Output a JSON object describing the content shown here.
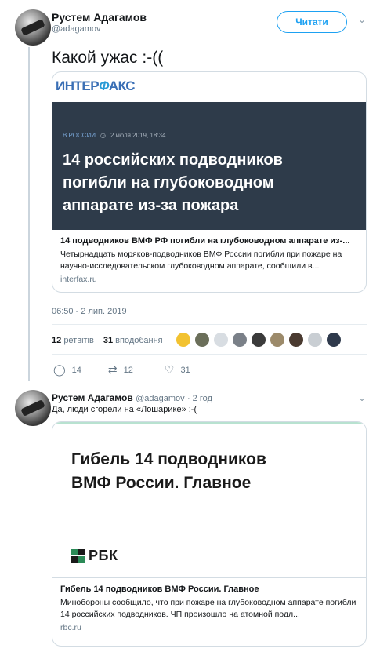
{
  "tweet": {
    "author_name": "Рустем Адагамов",
    "author_handle": "@adagamov",
    "follow_label": "Читати",
    "text": "Какой ужас :-((",
    "card": {
      "logo_part1": "ИНТЕР",
      "logo_slash": "Ф",
      "logo_part2": "АКС",
      "rubric": "В РОССИИ",
      "date": "2 июля 2019, 18:34",
      "headline": "14 российских подводников погибли на глубоководном аппарате из-за пожара",
      "title": "14 подводников ВМФ РФ погибли на глубоководном аппарате из-...",
      "description": "Четырнадцать моряков-подводников ВМФ России погибли при пожаре на научно-исследовательском глубоководном аппарате, сообщили в...",
      "domain": "interfax.ru"
    },
    "timestamp": "06:50 - 2 лип. 2019",
    "retweets_count": "12",
    "retweets_label": "ретвітів",
    "likes_count": "31",
    "likes_label": "вподобання",
    "actions": {
      "reply_count": "14",
      "retweet_count": "12",
      "like_count": "31"
    }
  },
  "reply": {
    "author_name": "Рустем Адагамов",
    "author_handle": "@adagamov",
    "time": "· 2 год",
    "text": "Да, люди сгорели на «Лошарике» :-(",
    "card": {
      "headline": "Гибель 14 подводников ВМФ России. Главное",
      "brand": "РБК",
      "title": "Гибель 14 подводников ВМФ России. Главное",
      "description": "Минобороны сообщило, что при пожаре на глубоководном аппарате погибли 14 российских подводников. ЧП произошло на атомной подл...",
      "domain": "rbc.ru"
    }
  },
  "icons": {
    "reply": "💬",
    "retweet": "⇄",
    "like": "♡",
    "chevron": "⌄"
  },
  "colors": {
    "accent": "#1da1f2",
    "hero_bg": "#2e3b4a",
    "rbk_green": "#2b8a57"
  }
}
